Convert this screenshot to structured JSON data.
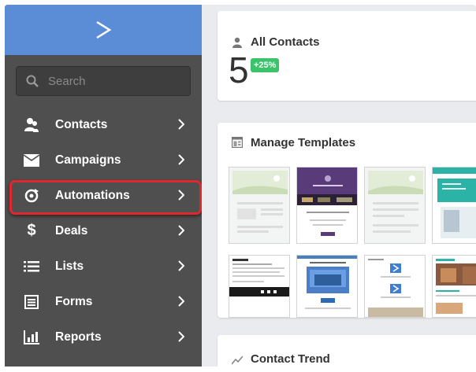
{
  "sidebar": {
    "search_placeholder": "Search",
    "items": [
      {
        "label": "Contacts",
        "icon": "contacts-icon"
      },
      {
        "label": "Campaigns",
        "icon": "envelope-icon"
      },
      {
        "label": "Automations",
        "icon": "automation-icon"
      },
      {
        "label": "Deals",
        "icon": "dollar-icon"
      },
      {
        "label": "Lists",
        "icon": "list-icon"
      },
      {
        "label": "Forms",
        "icon": "form-icon"
      },
      {
        "label": "Reports",
        "icon": "bar-chart-icon"
      }
    ],
    "highlighted_item": "Automations"
  },
  "all_contacts": {
    "title": "All Contacts",
    "count": "5",
    "change": "+25%"
  },
  "templates": {
    "title": "Manage Templates"
  },
  "trend": {
    "title": "Contact Trend"
  },
  "colors": {
    "brand": "#5b8dd6",
    "sidebar": "#4f4f4f",
    "highlight": "#e0272d",
    "badge": "#3cc26a"
  }
}
